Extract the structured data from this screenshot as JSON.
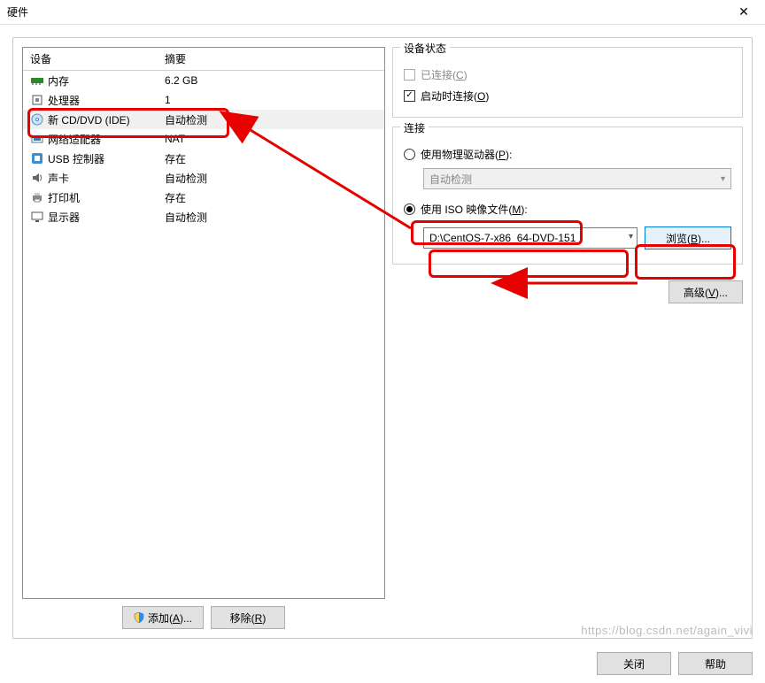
{
  "window": {
    "title": "硬件"
  },
  "device_table": {
    "header_device": "设备",
    "header_summary": "摘要",
    "rows": [
      {
        "icon": "memory-icon",
        "label": "内存",
        "summary": "6.2 GB"
      },
      {
        "icon": "cpu-icon",
        "label": "处理器",
        "summary": "1"
      },
      {
        "icon": "disc-icon",
        "label": "新 CD/DVD (IDE)",
        "summary": "自动检测",
        "selected": true
      },
      {
        "icon": "network-icon",
        "label": "网络适配器",
        "summary": "NAT"
      },
      {
        "icon": "usb-icon",
        "label": "USB 控制器",
        "summary": "存在"
      },
      {
        "icon": "sound-icon",
        "label": "声卡",
        "summary": "自动检测"
      },
      {
        "icon": "printer-icon",
        "label": "打印机",
        "summary": "存在"
      },
      {
        "icon": "display-icon",
        "label": "显示器",
        "summary": "自动检测"
      }
    ]
  },
  "buttons": {
    "add": "添加(A)...",
    "remove": "移除(R)",
    "close": "关闭",
    "help": "帮助",
    "browse": "浏览(B)...",
    "advanced": "高级(V)..."
  },
  "device_status": {
    "group_title": "设备状态",
    "connected_label": "已连接(C)",
    "connect_at_poweron_label": "启动时连接(O)"
  },
  "connection": {
    "group_title": "连接",
    "physical_label": "使用物理驱动器(P):",
    "physical_combo": "自动检测",
    "iso_label": "使用 ISO 映像文件(M):",
    "iso_path": "D:\\CentOS-7-x86_64-DVD-151"
  },
  "watermark": "https://blog.csdn.net/again_vivi"
}
